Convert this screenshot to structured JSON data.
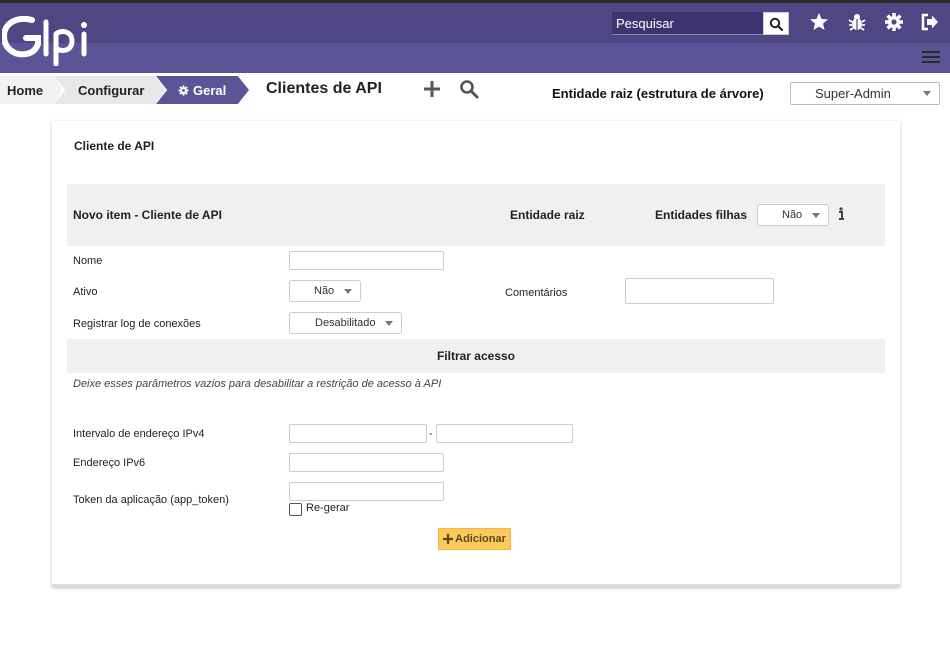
{
  "header": {
    "search_placeholder": "Pesquisar",
    "brand_color": "#4e4784"
  },
  "breadcrumb": {
    "home": "Home",
    "config": "Configurar",
    "current": "Geral"
  },
  "page": {
    "title": "Clientes de API",
    "entity": "Entidade raiz (estrutura de árvore)",
    "profile": "Super-Admin"
  },
  "form": {
    "panel_title": "Cliente de API",
    "header_new_item": "Novo item - Cliente de API",
    "header_entity": "Entidade raiz",
    "header_child_entities_label": "Entidades filhas",
    "header_child_entities_value": "Não",
    "name_label": "Nome",
    "name_value": "",
    "active_label": "Ativo",
    "active_value": "Não",
    "comments_label": "Comentários",
    "log_label": "Registrar log de conexões",
    "log_value": "Desabilitado",
    "filter_title": "Filtrar acesso",
    "filter_hint": "Deixe esses parâmetros vazios para desabilitar a restrição de acesso à API",
    "ipv4_label": "Intervalo de endereço IPv4",
    "ipv4_separator": "-",
    "ipv6_label": "Endereço IPv6",
    "token_label": "Token da aplicação (app_token)",
    "regen_label": "Re-gerar",
    "add_label": "Adicionar"
  }
}
